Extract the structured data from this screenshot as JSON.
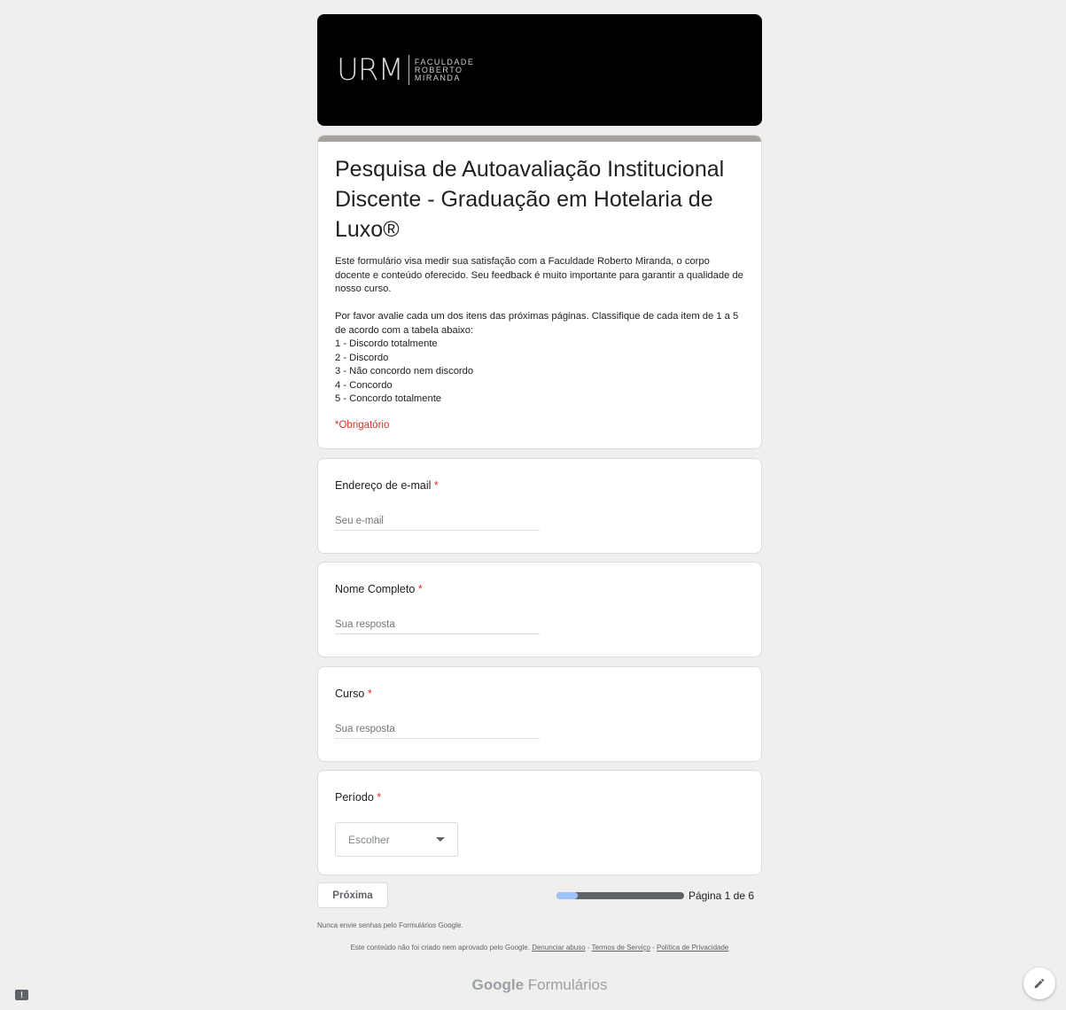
{
  "banner": {
    "logo_mark": "URM",
    "logo_text_line1": "FACULDADE",
    "logo_text_line2": "ROBERTO",
    "logo_text_line3": "MIRANDA"
  },
  "form": {
    "title": "Pesquisa de Autoavaliação Institucional Discente - Graduação em Hotelaria de Luxo®",
    "description_p1": "Este formulário visa medir sua satisfação com a Faculdade Roberto Miranda, o corpo docente e conteúdo oferecido. Seu feedback é muito importante para garantir a qualidade de nosso curso.",
    "description_p2": "Por favor avalie cada um dos itens das próximas páginas. Classifique de cada item de 1 a 5 de acordo com a tabela abaixo:",
    "scale": [
      "1 - Discordo totalmente",
      "2 - Discordo",
      "3 - Não concordo nem discordo",
      "4 - Concordo",
      "5 - Concordo totalmente"
    ],
    "required_note": "*Obrigatório"
  },
  "questions": [
    {
      "label": "Endereço de e-mail",
      "required_mark": "*",
      "placeholder": "Seu e-mail"
    },
    {
      "label": "Nome Completo",
      "required_mark": "*",
      "placeholder": "Sua resposta"
    },
    {
      "label": "Curso",
      "required_mark": "*",
      "placeholder": "Sua resposta"
    },
    {
      "label": "Período",
      "required_mark": "*",
      "select_value": "Escolher"
    }
  ],
  "navigation": {
    "next_label": "Próxima",
    "page_label": "Página 1 de 6",
    "progress_fraction": 0.1667
  },
  "footer": {
    "password_note": "Nunca envie senhas pelo Formulários Google.",
    "disclaimer": "Este conteúdo não foi criado nem aprovado pelo Google.",
    "report_link": "Denunciar abuso",
    "terms_link": "Termos de Serviço",
    "privacy_link": "Política de Privacidade",
    "separator": " - ",
    "brand_google": "Google",
    "brand_product": "Formulários"
  },
  "colors": {
    "required": "#d93025",
    "progress_fill": "#a0c3ff",
    "progress_track": "#5f6368",
    "title_bar": "#a6a39c"
  }
}
